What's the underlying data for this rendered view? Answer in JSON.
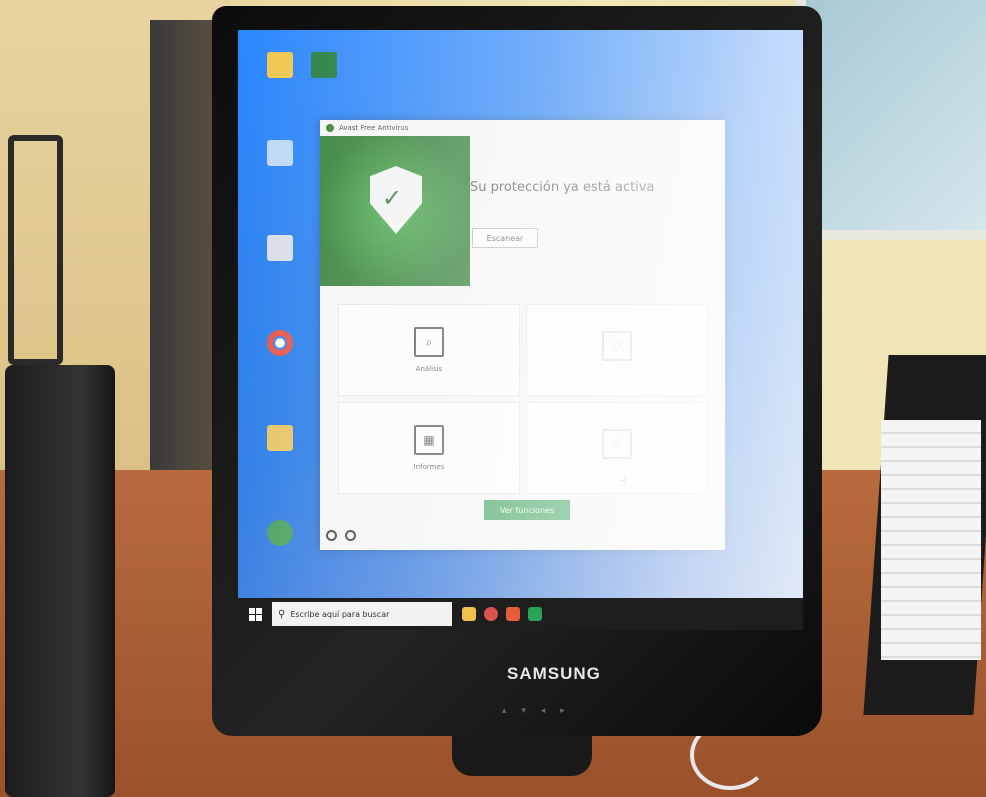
{
  "monitor": {
    "brand": "SAMSUNG"
  },
  "desktop": {
    "icons": [
      {
        "label": "",
        "color": "#f2c54b"
      },
      {
        "label": "",
        "color": "#1e7a3c"
      },
      {
        "label": "",
        "color": "#bcd6f3"
      },
      {
        "label": "",
        "color": "#d7dce3"
      },
      {
        "label": "",
        "color": "#e8e8e8"
      },
      {
        "label": "",
        "color": "#e6c15a"
      },
      {
        "label": "",
        "color": "#3c9a52"
      }
    ]
  },
  "taskbar": {
    "search_placeholder": "Escribe aquí para buscar",
    "apps": [
      {
        "icon": "folder-icon",
        "color": "#f0c14b"
      },
      {
        "icon": "chrome-icon",
        "color": "#d9534f"
      },
      {
        "icon": "app-icon",
        "color": "#e65c3c"
      },
      {
        "icon": "app-icon",
        "color": "#2aa35a"
      }
    ]
  },
  "avast": {
    "window_title": "Avast Free Antivirus",
    "status": "Su protección ya está activa",
    "status_sub": "",
    "outline_button": "Escanear",
    "tiles": [
      {
        "label": "Análisis",
        "icon": "scan-icon",
        "faded": false
      },
      {
        "label": "",
        "icon": "shield-icon",
        "faded": true
      },
      {
        "label": "Informes",
        "icon": "report-icon",
        "faded": false
      },
      {
        "label": "",
        "icon": "lock-icon",
        "faded": true
      }
    ],
    "green_button": "Ver funciones",
    "footer_text": ""
  }
}
